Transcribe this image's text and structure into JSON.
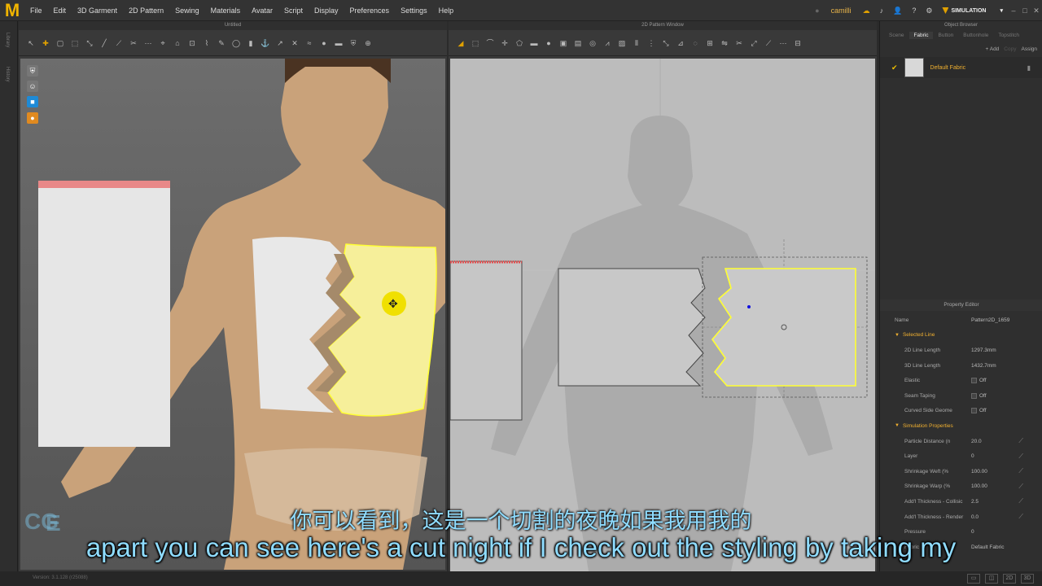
{
  "app": {
    "logo": "M",
    "menu": [
      "File",
      "Edit",
      "3D Garment",
      "2D Pattern",
      "Sewing",
      "Materials",
      "Avatar",
      "Script",
      "Display",
      "Preferences",
      "Settings",
      "Help"
    ],
    "username": "camilli",
    "mode": "SIMULATION"
  },
  "left_strip": {
    "labels": [
      "Library",
      "History"
    ]
  },
  "view3d": {
    "title": "Untitled"
  },
  "view2d": {
    "title": "2D Pattern Window"
  },
  "object_browser": {
    "title": "Object Browser",
    "tabs": [
      "Scene",
      "Fabric",
      "Button",
      "Buttonhole",
      "Topstitch"
    ],
    "active_tab": "Fabric",
    "actions": [
      "+ Add",
      "Copy",
      "Assign"
    ],
    "fabric_item": "Default Fabric"
  },
  "property_editor": {
    "title": "Property Editor",
    "name_label": "Name",
    "name_value": "Pattern2D_1659",
    "selected_line": {
      "label": "Selected Line",
      "rows": [
        {
          "name": "2D Line Length",
          "value": "1297.3mm"
        },
        {
          "name": "3D Line Length",
          "value": "1432.7mm"
        },
        {
          "name": "Elastic",
          "value": "Off"
        },
        {
          "name": "Seam Taping",
          "value": "Off"
        },
        {
          "name": "Curved Side Geome",
          "value": "Off"
        }
      ]
    },
    "simulation_properties": {
      "label": "Simulation Properties",
      "rows": [
        {
          "name": "Particle Distance (n",
          "value": "20.0"
        },
        {
          "name": "Layer",
          "value": "0"
        },
        {
          "name": "Shrinkage Weft (%",
          "value": "100.00"
        },
        {
          "name": "Shrinkage Warp (%",
          "value": "100.00"
        },
        {
          "name": "Add'l Thickness - Collisic",
          "value": "2.5"
        },
        {
          "name": "Add'l Thickness - Render",
          "value": "0.0"
        }
      ]
    },
    "pressure": {
      "label": "Pressure",
      "value": "0"
    },
    "fabric": {
      "label": "Fabric",
      "value": "Default Fabric"
    }
  },
  "status": {
    "version": "Version: 3.1.128  (r25088)"
  },
  "subtitles": {
    "cn": "你可以看到，这是一个切割的夜晚如果我用我的",
    "en": "apart you can see here's a cut night if I check out the styling by taking my"
  },
  "watermark": {
    "line1": "CG",
    "line2": "E"
  },
  "colors": {
    "accent": "#f0b400",
    "selection": "#ffff33",
    "subtitle": "#8fdcff"
  }
}
